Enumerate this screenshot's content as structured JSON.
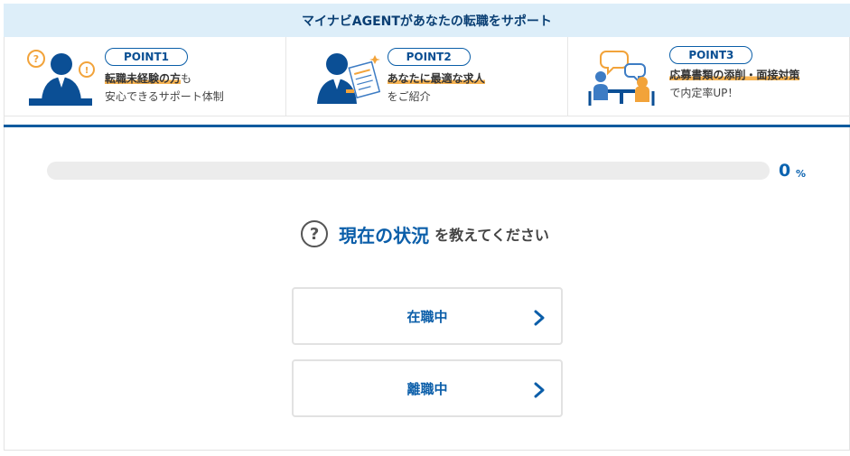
{
  "banner": {
    "title": "マイナビAGENTがあなたの転職をサポート"
  },
  "points": [
    {
      "badge": "POINT1",
      "highlight": "転職未経験の方",
      "suffix": "も",
      "line2": "安心できるサポート体制"
    },
    {
      "badge": "POINT2",
      "highlight": "あなたに最適な求人",
      "suffix": "",
      "line2": "をご紹介"
    },
    {
      "badge": "POINT3",
      "highlight": "応募書類の添削・面接対策",
      "suffix": "",
      "line2": "で内定率UP！"
    }
  ],
  "progress": {
    "value": 0,
    "number": "0",
    "unit": "%"
  },
  "question": {
    "icon": "question-circle-icon",
    "symbol": "?",
    "main": "現在の状況",
    "sub": "を教えてください"
  },
  "options": [
    {
      "label": "在職中",
      "icon": "chevron-right-icon"
    },
    {
      "label": "離職中",
      "icon": "chevron-right-icon"
    }
  ],
  "colors": {
    "brand_blue": "#0b5ea9",
    "banner_bg": "#ddeef9",
    "highlight_orange": "#f7b351",
    "divider": "#0b5b9e"
  }
}
